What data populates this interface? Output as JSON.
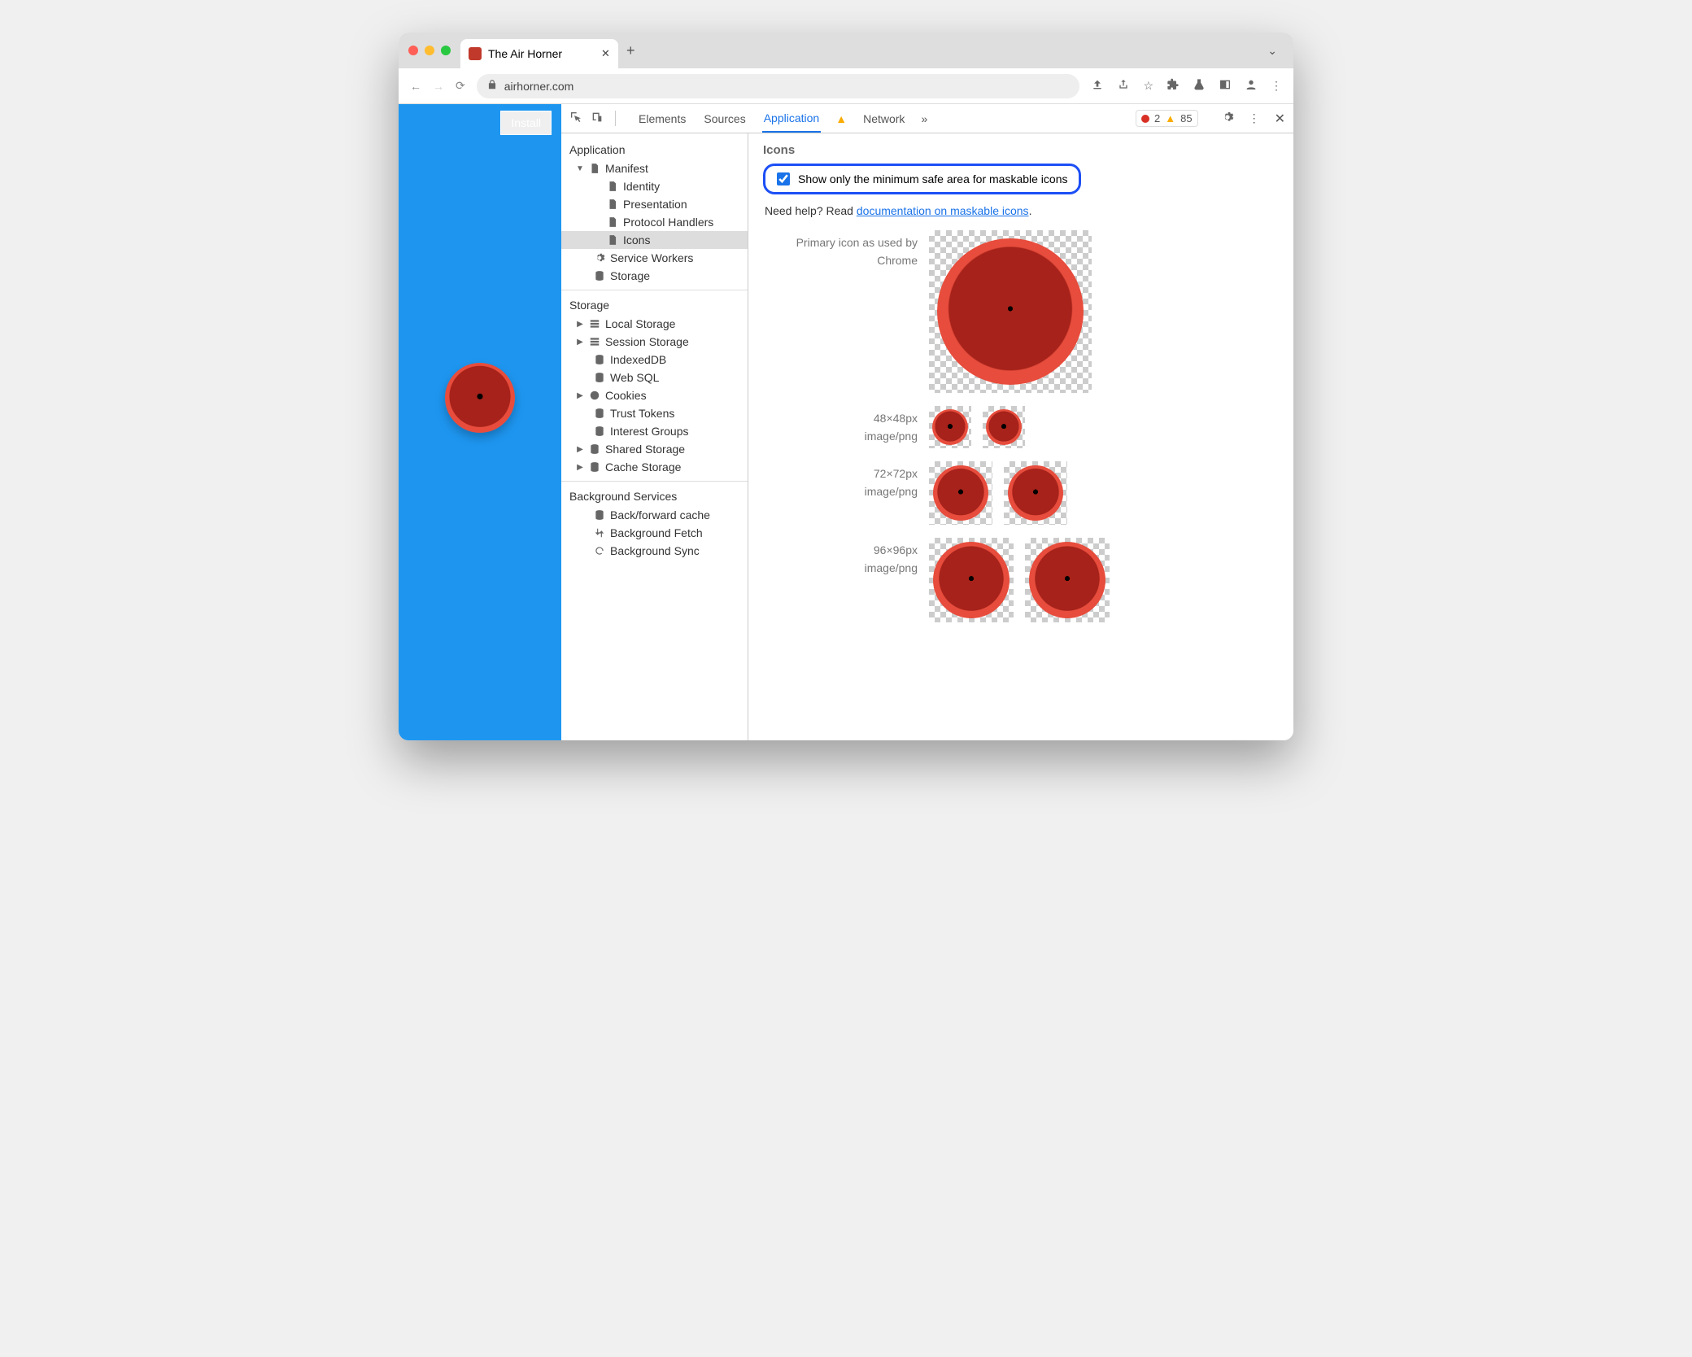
{
  "window": {
    "tab_title": "The Air Horner"
  },
  "url": {
    "domain": "airhorner.com"
  },
  "page": {
    "install_label": "Install"
  },
  "devtools": {
    "tabs": {
      "elements": "Elements",
      "sources": "Sources",
      "application": "Application",
      "network": "Network"
    },
    "errors": "2",
    "warnings": "85"
  },
  "sidebar": {
    "application": {
      "heading": "Application",
      "manifest": "Manifest",
      "identity": "Identity",
      "presentation": "Presentation",
      "protocol": "Protocol Handlers",
      "icons": "Icons",
      "sw": "Service Workers",
      "storage": "Storage"
    },
    "storage": {
      "heading": "Storage",
      "local": "Local Storage",
      "session": "Session Storage",
      "indexed": "IndexedDB",
      "websql": "Web SQL",
      "cookies": "Cookies",
      "trust": "Trust Tokens",
      "interest": "Interest Groups",
      "shared": "Shared Storage",
      "cache": "Cache Storage"
    },
    "bg": {
      "heading": "Background Services",
      "bf": "Back/forward cache",
      "fetch": "Background Fetch",
      "sync": "Background Sync"
    }
  },
  "content": {
    "heading": "Icons",
    "checkbox_label": "Show only the minimum safe area for maskable icons",
    "help_prefix": "Need help? Read ",
    "help_link": "documentation on maskable icons",
    "help_suffix": ".",
    "primary_l1": "Primary icon as used by",
    "primary_l2": "Chrome",
    "rows": {
      "r48": {
        "size": "48×48px",
        "mime": "image/png"
      },
      "r72": {
        "size": "72×72px",
        "mime": "image/png"
      },
      "r96": {
        "size": "96×96px",
        "mime": "image/png"
      }
    }
  }
}
